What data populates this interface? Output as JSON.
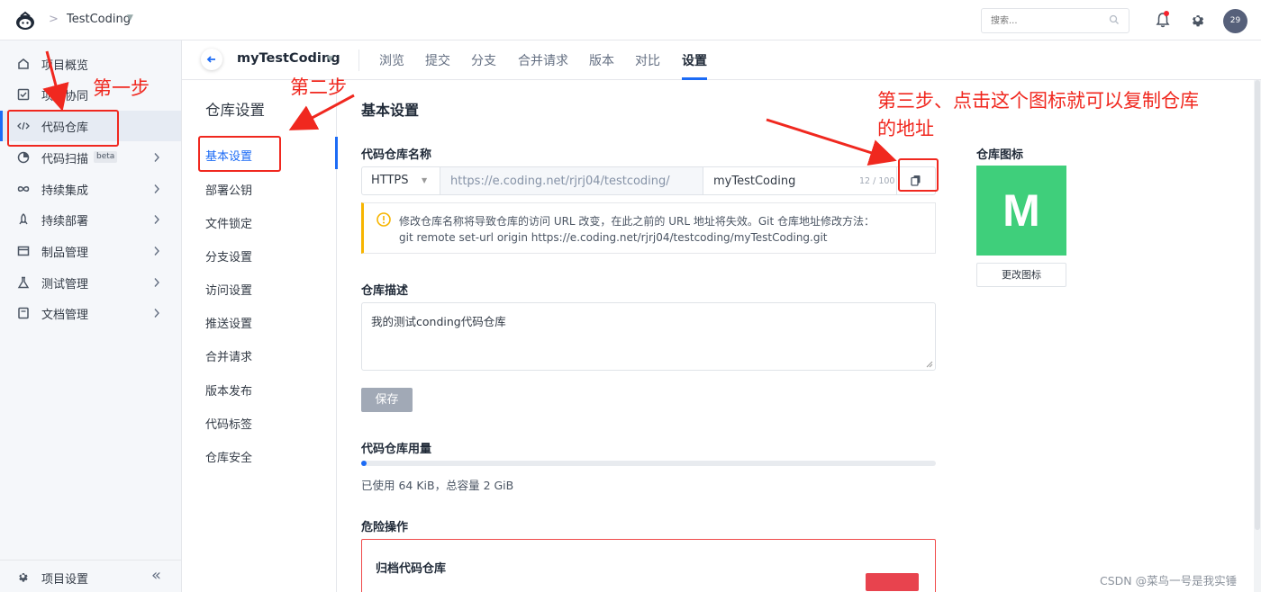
{
  "topbar": {
    "project_name": "TestCoding",
    "search_placeholder": "搜索...",
    "avatar_count": "29"
  },
  "sidebar": {
    "items": [
      {
        "label": "项目概览",
        "icon": "home-icon"
      },
      {
        "label": "项目协同",
        "icon": "checkbox-icon"
      },
      {
        "label": "代码仓库",
        "icon": "code-icon",
        "active": true
      },
      {
        "label": "代码扫描",
        "icon": "scan-icon",
        "badge": "beta"
      },
      {
        "label": "持续集成",
        "icon": "infinity-icon"
      },
      {
        "label": "持续部署",
        "icon": "rocket-icon"
      },
      {
        "label": "制品管理",
        "icon": "package-icon"
      },
      {
        "label": "测试管理",
        "icon": "flask-icon"
      },
      {
        "label": "文档管理",
        "icon": "book-icon"
      }
    ],
    "bottom_label": "项目设置",
    "collapse_glyph": "«"
  },
  "repo_nav": {
    "title": "myTestCoding",
    "tabs": [
      "浏览",
      "提交",
      "分支",
      "合并请求",
      "版本",
      "对比",
      "设置"
    ],
    "active_tab": "设置"
  },
  "settings_nav": {
    "title": "仓库设置",
    "items": [
      "基本设置",
      "部署公钥",
      "文件锁定",
      "分支设置",
      "访问设置",
      "推送设置",
      "合并请求",
      "版本发布",
      "代码标签",
      "仓库安全"
    ],
    "active": "基本设置"
  },
  "main": {
    "heading": "基本设置",
    "name_label": "代码仓库名称",
    "protocol": "HTTPS",
    "url_prefix": "https://e.coding.net/rjrj04/testcoding/",
    "repo_name_value": "myTestCoding",
    "char_count": "12 / 100",
    "warning_line1": "修改仓库名称将导致仓库的访问 URL 改变，在此之前的 URL 地址将失效。Git 仓库地址修改方法：",
    "warning_line2": "git remote set-url origin https://e.coding.net/rjrj04/testcoding/myTestCoding.git",
    "desc_label": "仓库描述",
    "desc_value": "我的测试conding代码仓库",
    "save_label": "保存",
    "usage_label": "代码仓库用量",
    "usage_fraction": 0.01,
    "usage_text": "已使用 64 KiB，总容量 2 GiB",
    "danger_label": "危险操作",
    "archive_title": "归档代码仓库"
  },
  "icon_panel": {
    "label": "仓库图标",
    "letter": "M",
    "change_label": "更改图标",
    "color": "#3fcf7b"
  },
  "annotations": {
    "step1": "第一步",
    "step2": "第二步",
    "step3_line1": "第三步、点击这个图标就可以复制仓库",
    "step3_line2": "的地址"
  },
  "watermark": "CSDN @菜鸟一号是我实锤",
  "colors": {
    "accent": "#1c6bf5",
    "annotation": "#f0281f",
    "warning": "#f7b500",
    "danger": "#f04a4a"
  }
}
